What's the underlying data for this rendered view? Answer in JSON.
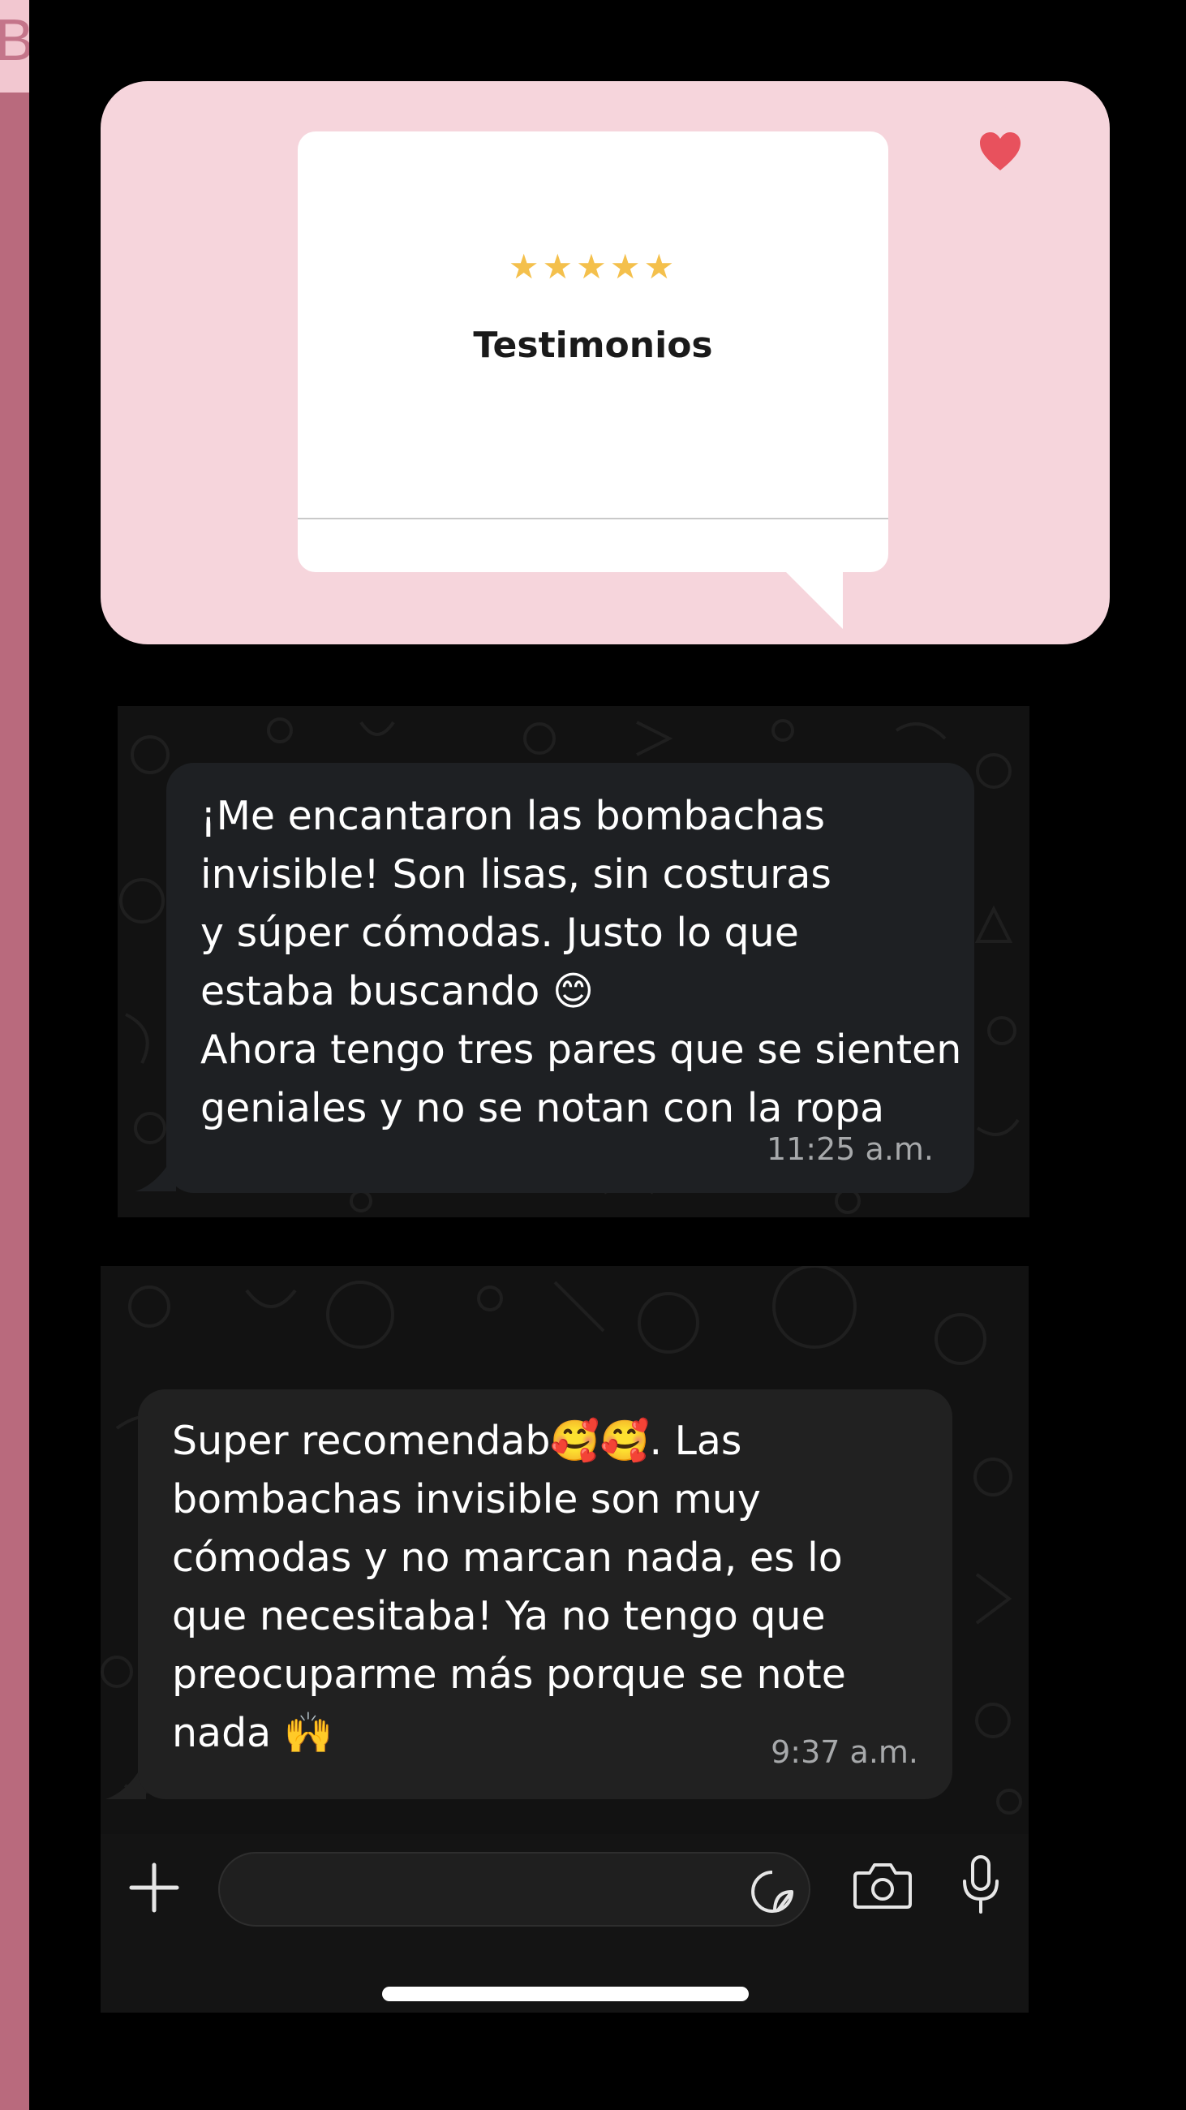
{
  "sidebar": {
    "letter": "B"
  },
  "banner": {
    "stars": "★★★★★",
    "title": "Testimonios",
    "heart_icon": "heart-icon"
  },
  "messages": [
    {
      "text": "¡Me encantaron las bombachas\ninvisible! Son lisas, sin costuras\ny súper cómodas. Justo lo que\nestaba buscando 😊\nAhora tengo tres pares que se sienten\ngeniales y no se notan con la ropa",
      "time": "11:25 a.m."
    },
    {
      "text": "Super recomendab🥰🥰. Las\nbombachas invisible son muy\ncómodas y no marcan nada, es lo\nque necesitaba! Ya no tengo que\npreocuparme más porque se note\nnada 🙌",
      "time": "9:37 a.m."
    }
  ],
  "input_bar": {
    "placeholder": "",
    "icons": [
      "plus-icon",
      "sticker-icon",
      "camera-icon",
      "microphone-icon"
    ]
  },
  "colors": {
    "banner_bg": "#f6d5dc",
    "star": "#f4c04c",
    "heart": "#e8515d",
    "bubble_bg": "#1e2023",
    "left_strip": "#b96a7d"
  }
}
